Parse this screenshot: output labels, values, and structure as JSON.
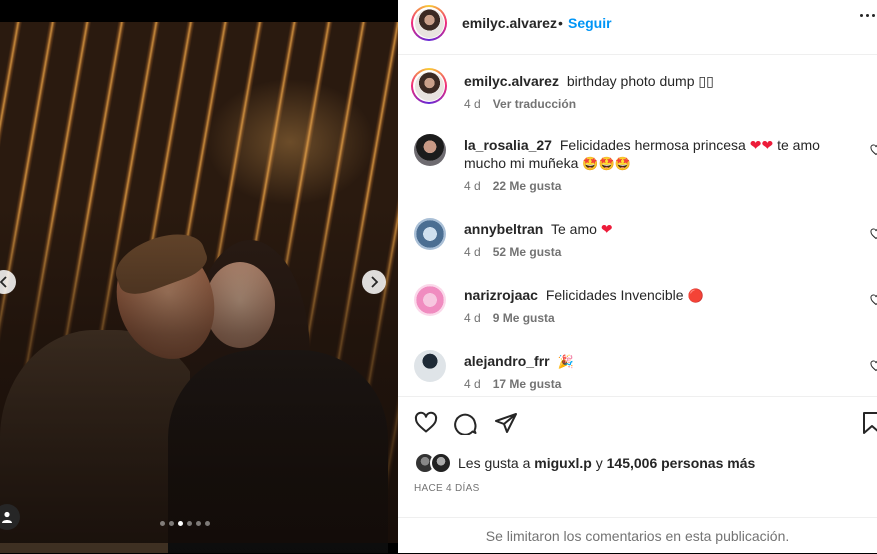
{
  "post": {
    "author": "emilyc.alvarez",
    "follow_label": "Seguir",
    "bullet": "•",
    "caption": {
      "username": "emilyc.alvarez",
      "text": "birthday photo dump ▯▯",
      "time": "4 d",
      "translate_label": "Ver traducción"
    },
    "likes": {
      "prefix": "Les gusta a",
      "user": "miguxl.p",
      "joiner": "y",
      "count": "145,006 personas más"
    },
    "date": "HACE 4 DÍAS",
    "comments_disabled": "Se limitaron los comentarios en esta publicación.",
    "carousel": {
      "total": 6,
      "current": 3
    }
  },
  "comments": [
    {
      "username": "la_rosalia_27",
      "text": "Felicidades hermosa princesa",
      "text2": "te amo mucho mi muñeka",
      "emoji_hearts": "❤❤",
      "emoji_faces": "🤩🤩🤩",
      "time": "4 d",
      "likes": "22 Me gusta"
    },
    {
      "username": "annybeltran",
      "text": "Te amo",
      "emoji_hearts": "❤",
      "time": "4 d",
      "likes": "52 Me gusta"
    },
    {
      "username": "narizrojaac",
      "text": "Felicidades Invencible",
      "emoji": "🔴",
      "time": "4 d",
      "likes": "9 Me gusta"
    },
    {
      "username": "alejandro_frr",
      "text": "",
      "emoji": "🎉",
      "time": "4 d",
      "likes": "17 Me gusta"
    }
  ],
  "colors": {
    "accent": "#0095f6",
    "heart": "#ed1c3a",
    "muted": "#737373"
  },
  "icons": [
    "chevron-left-icon",
    "chevron-right-icon",
    "tag-person-icon",
    "more-options-icon",
    "heart-outline-icon",
    "comment-icon",
    "share-icon",
    "bookmark-icon"
  ]
}
